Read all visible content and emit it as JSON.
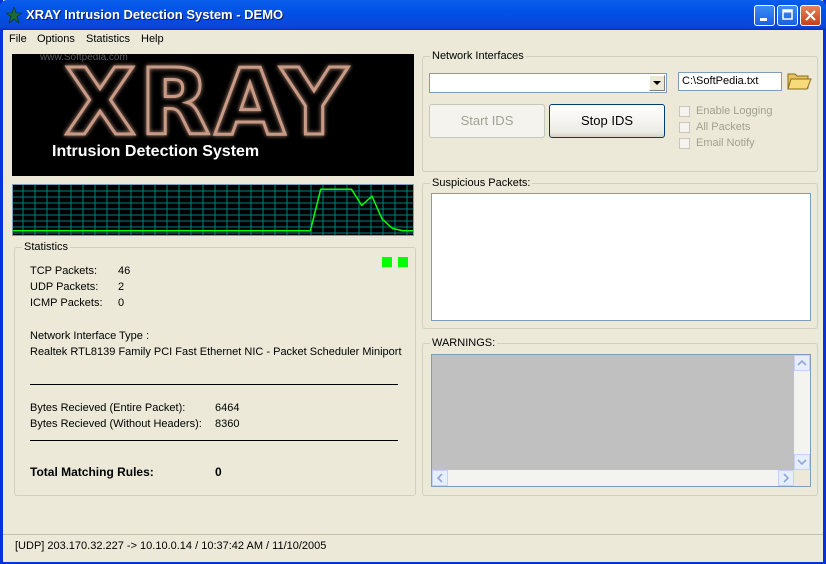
{
  "window": {
    "title": "XRAY Intrusion Detection System - DEMO"
  },
  "menu": {
    "items": [
      "File",
      "Options",
      "Statistics",
      "Help"
    ]
  },
  "logo": {
    "main_text": "XRAY",
    "subtitle": "Intrusion Detection System",
    "watermark": "www.Softpedia.com"
  },
  "graph": {
    "traffic_level": [
      0.05,
      0.05,
      0.05,
      0.05,
      0.05,
      0.05,
      0.05,
      0.05,
      0.05,
      0.05,
      0.05,
      0.05,
      0.05,
      0.05,
      0.05,
      0.05,
      0.05,
      0.05,
      0.05,
      0.05,
      0.05,
      0.05,
      0.05,
      0.05,
      0.05,
      0.05,
      0.05,
      0.05,
      0.05,
      0.05,
      0.95,
      0.95,
      0.95,
      0.95,
      0.6,
      0.8,
      0.3,
      0.1,
      0.05,
      0.05
    ]
  },
  "statistics": {
    "group_label": "Statistics",
    "tcp_label": "TCP Packets:",
    "tcp_value": "46",
    "udp_label": "UDP Packets:",
    "udp_value": "2",
    "icmp_label": "ICMP Packets:",
    "icmp_value": "0",
    "nit_label": "Network Interface Type :",
    "nit_value": "Realtek RTL8139 Family PCI Fast Ethernet NIC - Packet Scheduler Miniport",
    "bytes_entire_label": "Bytes Recieved (Entire Packet):",
    "bytes_entire_value": "6464",
    "bytes_noheaders_label": "Bytes Recieved (Without Headers):",
    "bytes_noheaders_value": "8360",
    "rules_label": "Total Matching Rules:",
    "rules_value": "0"
  },
  "network": {
    "group_label": "Network Interfaces",
    "interface_selected": "",
    "log_file": "C:\\SoftPedia.txt",
    "start_label": "Start IDS",
    "stop_label": "Stop IDS",
    "enable_logging": "Enable Logging",
    "all_packets": "All Packets",
    "email_notify": "Email Notify"
  },
  "suspicious": {
    "group_label": "Suspicious Packets:"
  },
  "warnings": {
    "group_label": "WARNINGS:"
  },
  "status": {
    "text": "[UDP] 203.170.32.227 -> 10.10.0.14 / 10:37:42 AM / 11/10/2005"
  },
  "colors": {
    "titlebar": "#0A5EEA",
    "graph_line": "#00FF00",
    "graph_grid": "#008080",
    "indicator": "#00FF00"
  }
}
